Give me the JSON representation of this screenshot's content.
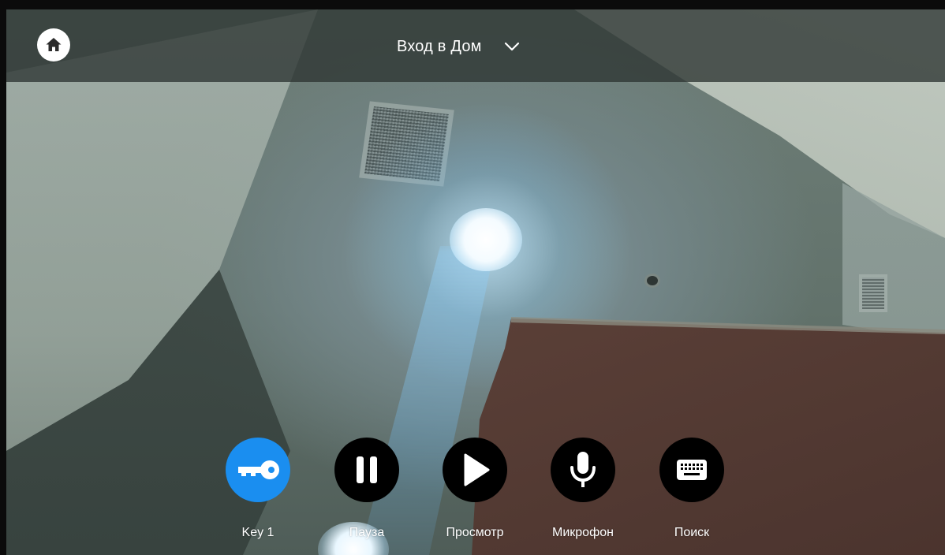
{
  "header": {
    "title": "Вход в Дом",
    "home_icon": "home-icon",
    "dropdown_icon": "chevron-down-icon"
  },
  "controls": [
    {
      "label": "Key 1",
      "icon": "key-icon",
      "active": true
    },
    {
      "label": "Пауза",
      "icon": "pause-icon",
      "active": false
    },
    {
      "label": "Просмотр",
      "icon": "play-icon",
      "active": false
    },
    {
      "label": "Микрофон",
      "icon": "microphone-icon",
      "active": false
    },
    {
      "label": "Поиск",
      "icon": "keyboard-icon",
      "active": false
    }
  ],
  "colors": {
    "accent": "#1a8ef0",
    "button": "#000000",
    "bar": "#2d3432",
    "text": "#ffffff"
  }
}
